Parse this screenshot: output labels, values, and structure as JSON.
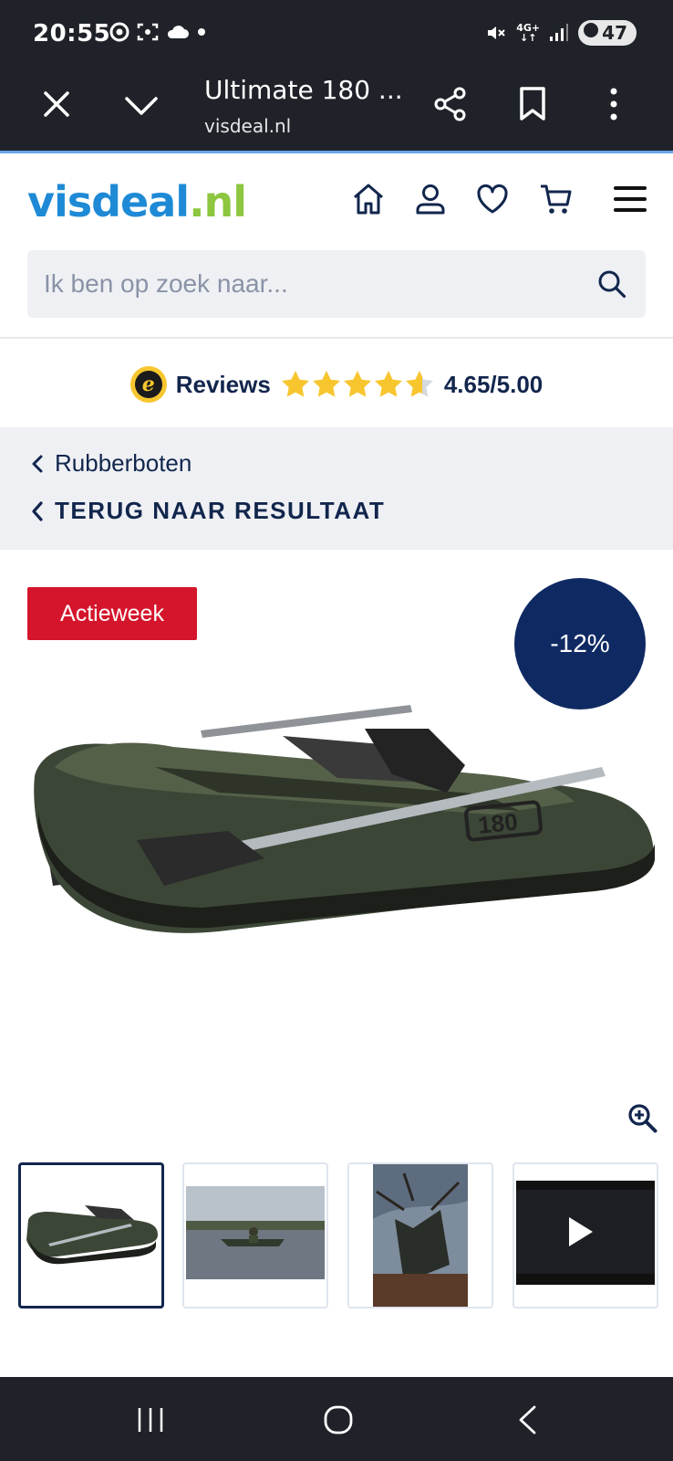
{
  "status_bar": {
    "time": "20:55",
    "network": "4G+",
    "battery": "47"
  },
  "browser": {
    "page_title": "Ultimate 180 ...",
    "url": "visdeal.nl"
  },
  "site": {
    "logo_main": "visdeal",
    "logo_tld": ".nl",
    "search_placeholder": "Ik ben op zoek naar..."
  },
  "reviews": {
    "badge": "e",
    "label": "Reviews",
    "score": "4.65/5.00",
    "rating": 4.65
  },
  "breadcrumb": {
    "category": "Rubberboten",
    "back": "TERUG NAAR RESULTAAT"
  },
  "product": {
    "promo_badge": "Actieweek",
    "discount": "-12%",
    "hull_text": "180"
  },
  "thumbnails": [
    {
      "name": "thumbnail-boat-studio",
      "active": true
    },
    {
      "name": "thumbnail-boat-lake",
      "active": false
    },
    {
      "name": "thumbnail-boat-tree",
      "active": false
    },
    {
      "name": "thumbnail-video",
      "active": false
    }
  ],
  "colors": {
    "accent_navy": "#12264d",
    "promo_red": "#d4152b",
    "discount_navy": "#0f2a63",
    "logo_blue": "#1e8ad6",
    "logo_green": "#8dc63f",
    "star_yellow": "#f7c62f"
  }
}
